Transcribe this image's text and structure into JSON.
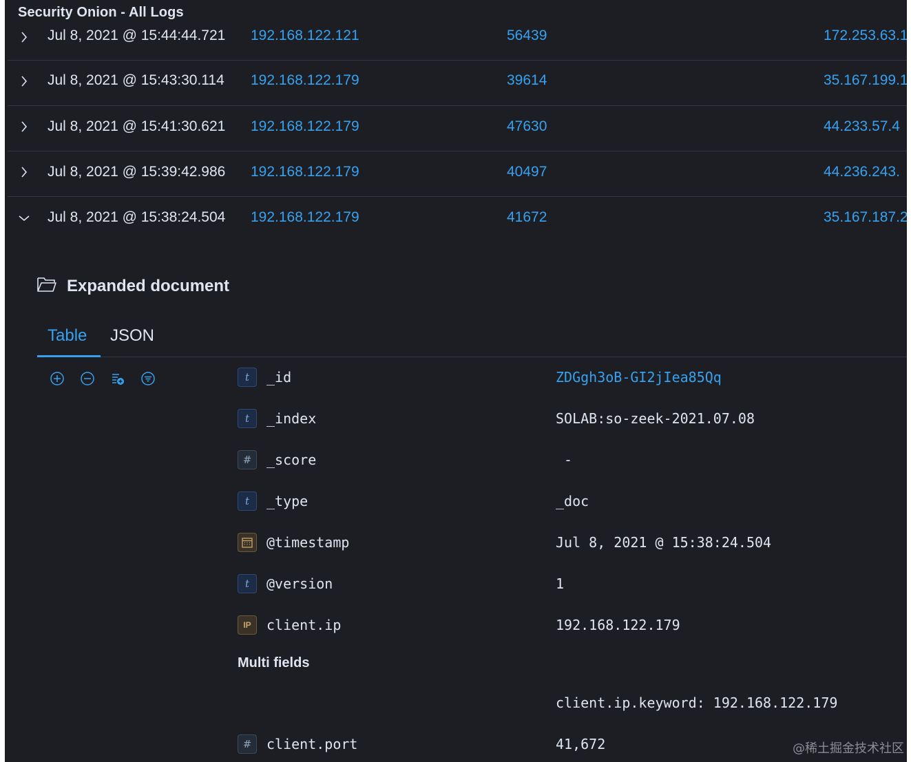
{
  "app": {
    "title": "Security Onion - All Logs"
  },
  "rows": [
    {
      "timestamp": "Jul 8, 2021 @ 15:44:44.721",
      "source_ip": "192.168.122.121",
      "source_port": "56439",
      "dest_ip": "172.253.63.1",
      "expanded": false
    },
    {
      "timestamp": "Jul 8, 2021 @ 15:43:30.114",
      "source_ip": "192.168.122.179",
      "source_port": "39614",
      "dest_ip": "35.167.199.1",
      "expanded": false
    },
    {
      "timestamp": "Jul 8, 2021 @ 15:41:30.621",
      "source_ip": "192.168.122.179",
      "source_port": "47630",
      "dest_ip": "44.233.57.4",
      "expanded": false
    },
    {
      "timestamp": "Jul 8, 2021 @ 15:39:42.986",
      "source_ip": "192.168.122.179",
      "source_port": "40497",
      "dest_ip": "44.236.243.",
      "expanded": false
    },
    {
      "timestamp": "Jul 8, 2021 @ 15:38:24.504",
      "source_ip": "192.168.122.179",
      "source_port": "41672",
      "dest_ip": "35.167.187.2",
      "expanded": true
    }
  ],
  "expanded": {
    "title": "Expanded document",
    "tabs": [
      {
        "label": "Table",
        "active": true
      },
      {
        "label": "JSON",
        "active": false
      }
    ],
    "toolbar_icons": [
      "plus-circle-icon",
      "minus-circle-icon",
      "toggle-column-icon",
      "filter-exists-icon"
    ],
    "fields": [
      {
        "type": "t",
        "name": "_id",
        "value": "ZDGgh3oB-GI2jIea85Qq",
        "link": true
      },
      {
        "type": "t",
        "name": "_index",
        "value": "SOLAB:so-zeek-2021.07.08",
        "link": false
      },
      {
        "type": "#",
        "name": "_score",
        "value": " -",
        "link": false
      },
      {
        "type": "t",
        "name": "_type",
        "value": "_doc",
        "link": false
      },
      {
        "type": "date",
        "name": "@timestamp",
        "value": "Jul 8, 2021 @ 15:38:24.504",
        "link": false
      },
      {
        "type": "t",
        "name": "@version",
        "value": "1",
        "link": false
      },
      {
        "type": "IP",
        "name": "client.ip",
        "value": "192.168.122.179",
        "link": false
      }
    ],
    "multi_fields_label": "Multi fields",
    "multi_field_value": "client.ip.keyword: 192.168.122.179",
    "client_port": {
      "type": "#",
      "name": "client.port",
      "value": "41,672"
    }
  },
  "watermark": "@稀土掘金技术社区",
  "colors": {
    "background": "#1d1e24",
    "link": "#36a2ef",
    "text": "#dfe5ef",
    "divider": "#343741"
  }
}
